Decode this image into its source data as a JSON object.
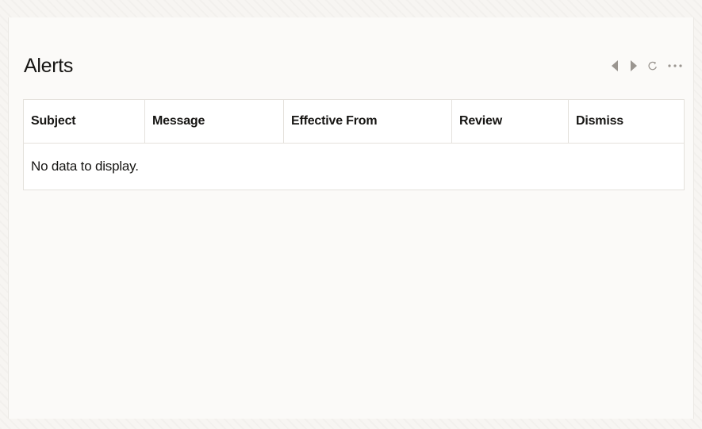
{
  "panel": {
    "title": "Alerts",
    "toolbar": {
      "prev_icon": "caret-left-icon",
      "next_icon": "caret-right-icon",
      "refresh_icon": "refresh-icon",
      "more_icon": "more-horizontal-icon"
    }
  },
  "table": {
    "columns": [
      "Subject",
      "Message",
      "Effective From",
      "Review",
      "Dismiss"
    ],
    "empty_message": "No data to display."
  },
  "colors": {
    "background": "#f7f5f2",
    "panel": "#fbfaf8",
    "table_bg": "#ffffff",
    "border": "#e4e1dc",
    "icon": "#8a8580"
  }
}
